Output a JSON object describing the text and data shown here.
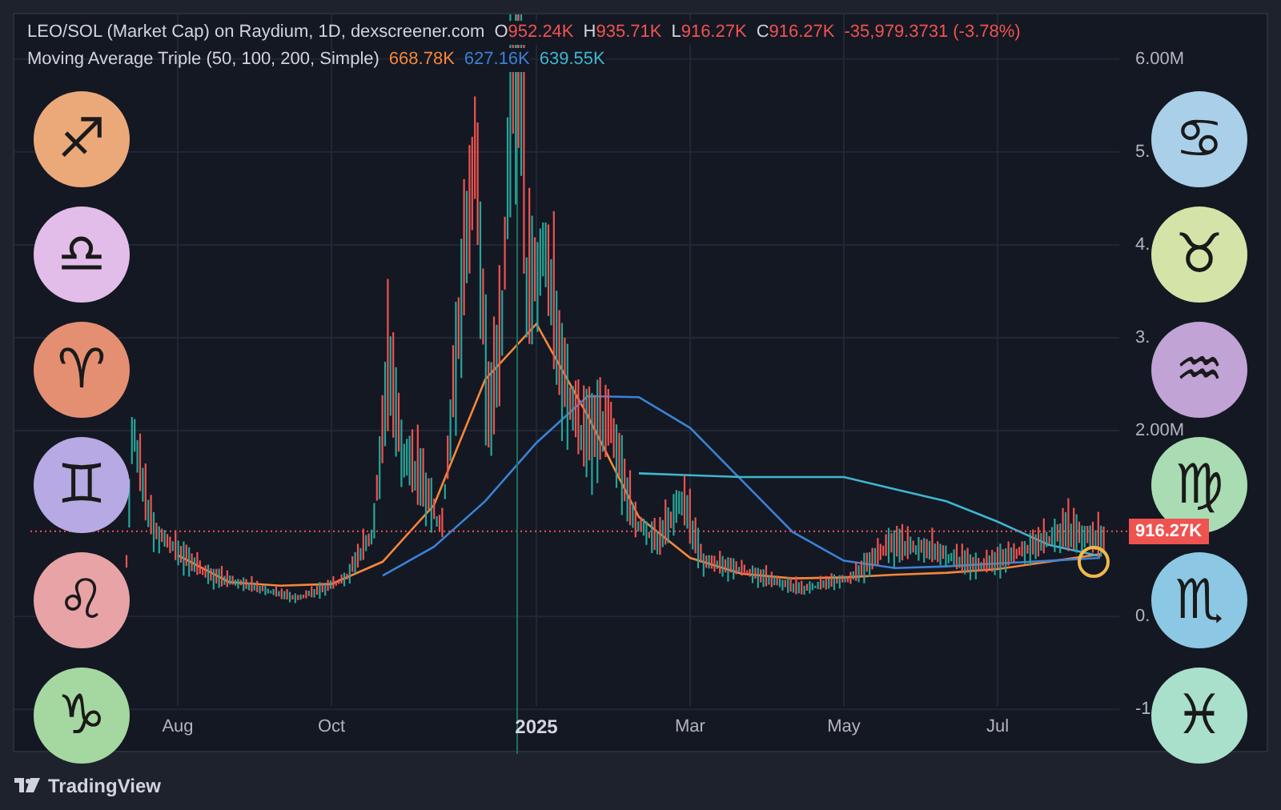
{
  "legend": {
    "title": "LEO/SOL (Market Cap) on Raydium, 1D, dexscreener.com",
    "ohlc": [
      {
        "key": "O",
        "value": "952.24K"
      },
      {
        "key": "H",
        "value": "935.71K"
      },
      {
        "key": "L",
        "value": "916.27K"
      },
      {
        "key": "C",
        "value": "916.27K"
      }
    ],
    "change": "-35,979.3731 (-3.78%)",
    "indicator": "Moving Average Triple (50, 100, 200, Simple)",
    "ma_values": [
      {
        "value": "668.78K",
        "color": "#f7873a"
      },
      {
        "value": "627.16K",
        "color": "#3b82d6"
      },
      {
        "value": "639.55K",
        "color": "#3fb6cf"
      }
    ]
  },
  "chart_data": {
    "type": "line",
    "categories": [
      null,
      "Aug",
      null,
      null,
      "Oct",
      null,
      null,
      null,
      "**2025**",
      null,
      null,
      "Mar",
      null,
      null,
      "May",
      null,
      null,
      "Jul",
      null,
      null
    ],
    "ylim": [
      -1.48,
      6.48
    ],
    "grid": true,
    "ref_lines": [
      {
        "axis": "y",
        "value": 0.91627,
        "label": "916.27K",
        "color": "#ef5350"
      }
    ],
    "series": [
      {
        "color": "#f7873a",
        "values": [
          null,
          0.66,
          0.37,
          0.33,
          0.35,
          0.59,
          1.2,
          2.55,
          3.15,
          2.16,
          1.07,
          0.63,
          0.46,
          0.41,
          0.42,
          0.45,
          0.47,
          0.51,
          0.59,
          0.67
        ]
      },
      {
        "color": "#3b82d6",
        "values": [
          null,
          null,
          null,
          null,
          null,
          0.44,
          0.75,
          1.24,
          1.87,
          2.37,
          2.36,
          2.03,
          1.47,
          0.91,
          0.6,
          0.52,
          0.54,
          0.57,
          0.6,
          0.63
        ]
      },
      {
        "color": "#3fb6cf",
        "values": [
          null,
          null,
          null,
          null,
          null,
          null,
          null,
          null,
          null,
          null,
          1.54,
          1.52,
          1.5,
          1.5,
          1.5,
          1.37,
          1.24,
          1.02,
          0.77,
          0.65
        ]
      }
    ],
    "yticks": [
      {
        "value": 6,
        "label": "6.00M"
      },
      {
        "value": 5,
        "label": "5."
      },
      {
        "value": 4,
        "label": "4."
      },
      {
        "value": 3,
        "label": "3."
      },
      {
        "value": 2,
        "label": "2.00M"
      },
      {
        "value": 0,
        "label": "0."
      },
      {
        "value": -1,
        "label": "-1"
      }
    ]
  },
  "zodiac_left": [
    {
      "symbol": "♐",
      "color": "#eba97a"
    },
    {
      "symbol": "♎",
      "color": "#e2bde9"
    },
    {
      "symbol": "♈",
      "color": "#e58f72"
    },
    {
      "symbol": "♊",
      "color": "#b7a9e3"
    },
    {
      "symbol": "♌",
      "color": "#e8a3a6"
    },
    {
      "symbol": "♑",
      "color": "#a5d8a0"
    }
  ],
  "zodiac_right": [
    {
      "symbol": "♋",
      "color": "#a9cfe9"
    },
    {
      "symbol": "♉",
      "color": "#d4e4a8"
    },
    {
      "symbol": "♒",
      "color": "#c1a3d6"
    },
    {
      "symbol": "♍",
      "color": "#a9dcb3"
    },
    {
      "symbol": "♏",
      "color": "#8cc8e3"
    },
    {
      "symbol": "♓",
      "color": "#a8e0cc"
    }
  ],
  "footer": {
    "brand": "TradingView"
  }
}
